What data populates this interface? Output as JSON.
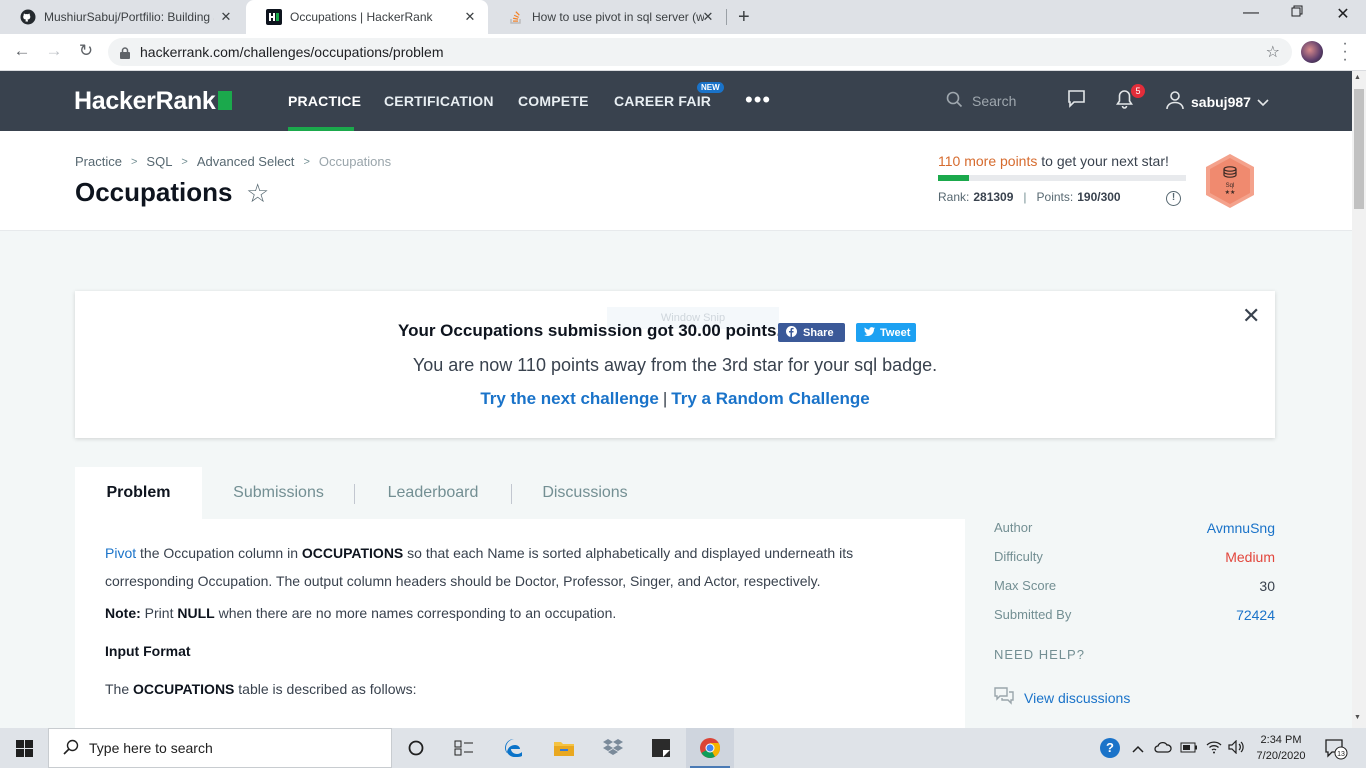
{
  "browser": {
    "tabs": [
      {
        "title": "MushiurSabuj/Portfilio: Building a",
        "icon": "github-icon"
      },
      {
        "title": "Occupations | HackerRank",
        "icon": "hackerrank-icon"
      },
      {
        "title": "How to use pivot in sql server (wi",
        "icon": "stackoverflow-icon"
      }
    ],
    "url": "hackerrank.com/challenges/occupations/problem"
  },
  "nav": {
    "logo": "HackerRank",
    "links": [
      "PRACTICE",
      "CERTIFICATION",
      "COMPETE",
      "CAREER FAIR"
    ],
    "new_badge": "NEW",
    "search_placeholder": "Search",
    "notification_count": "5",
    "username": "sabuj987"
  },
  "header": {
    "breadcrumb": [
      "Practice",
      "SQL",
      "Advanced Select",
      "Occupations"
    ],
    "title": "Occupations",
    "points_highlight": "110 more points",
    "points_rest": " to get your next star!",
    "progress_fraction": 0.127,
    "rank_label": "Rank:",
    "rank_value": "281309",
    "points_label": "Points:",
    "points_value": "190/300",
    "badge_label": "Sql"
  },
  "banner": {
    "ghost_text": "Window Snip",
    "headline": "Your Occupations submission got 30.00 points.",
    "share_label": "Share",
    "tweet_label": "Tweet",
    "subtext": "You are now 110 points away from the 3rd star for your sql badge.",
    "link_next": "Try the next challenge",
    "link_random": "Try a Random Challenge"
  },
  "content_tabs": [
    "Problem",
    "Submissions",
    "Leaderboard",
    "Discussions"
  ],
  "problem": {
    "p1_link": "Pivot",
    "p1_a": " the Occupation column in ",
    "p1_bold": "OCCUPATIONS",
    "p1_b": " so that each Name is sorted alphabetically and displayed underneath its corresponding Occupation. The output column headers should be Doctor, Professor, Singer, and Actor, respectively.",
    "note_label": "Note:",
    "note_a": " Print ",
    "note_bold": "NULL",
    "note_b": " when there are no more names corresponding to an occupation.",
    "input_format": "Input Format",
    "desc_a": "The ",
    "desc_bold": "OCCUPATIONS",
    "desc_b": " table is described as follows:"
  },
  "sidebar": {
    "author_label": "Author",
    "author": "AvmnuSng",
    "difficulty_label": "Difficulty",
    "difficulty": "Medium",
    "max_score_label": "Max Score",
    "max_score": "30",
    "submitted_label": "Submitted By",
    "submitted": "72424",
    "need_help": "NEED HELP?",
    "view_discussions": "View discussions"
  },
  "taskbar": {
    "search_placeholder": "Type here to search",
    "time": "2:34 PM",
    "date": "7/20/2020",
    "notifications": "13"
  },
  "colors": {
    "nav_bg": "#39424e",
    "accent_green": "#1ba94c",
    "link_blue": "#1a73c9",
    "medium_red": "#e2463c",
    "facebook": "#3b5998",
    "twitter": "#1da1f2"
  }
}
